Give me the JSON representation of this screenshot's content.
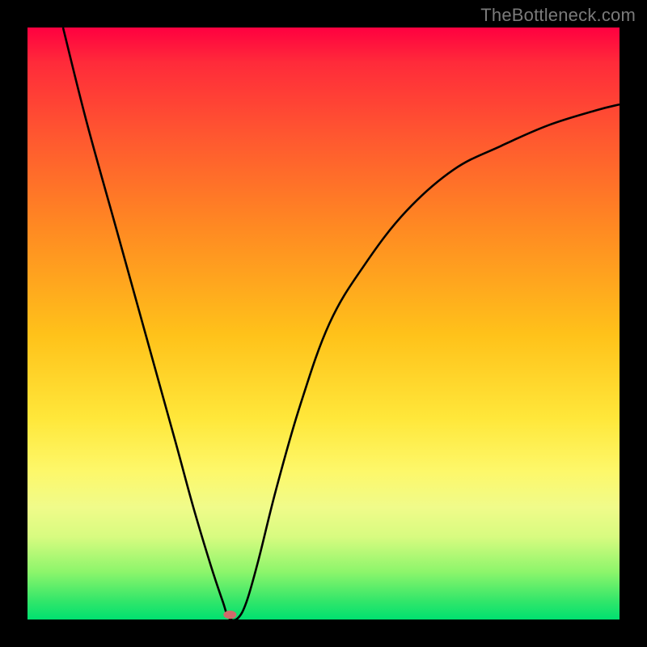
{
  "watermark": "TheBottleneck.com",
  "chart_data": {
    "type": "line",
    "title": "",
    "xlabel": "",
    "ylabel": "",
    "xlim": [
      0,
      100
    ],
    "ylim": [
      0,
      100
    ],
    "grid": false,
    "legend": false,
    "background_gradient": [
      "#ff0040",
      "#ff8a22",
      "#ffe73a",
      "#00e070"
    ],
    "series": [
      {
        "name": "bottleneck-curve",
        "stroke": "#000000",
        "x": [
          6,
          10,
          15,
          20,
          25,
          28,
          31,
          33,
          34,
          35.5,
          37,
          39,
          42,
          46,
          51,
          57,
          64,
          72,
          80,
          88,
          96,
          100
        ],
        "values": [
          100,
          84,
          66,
          48,
          30,
          19,
          9,
          3,
          0.3,
          0.2,
          3,
          10,
          22,
          36,
          50,
          60,
          69,
          76,
          80,
          83.5,
          86,
          87
        ]
      }
    ],
    "marker": {
      "x": 34.2,
      "y": 0.8,
      "color": "#d06a6a",
      "rx": 1.1,
      "ry": 0.7
    }
  }
}
